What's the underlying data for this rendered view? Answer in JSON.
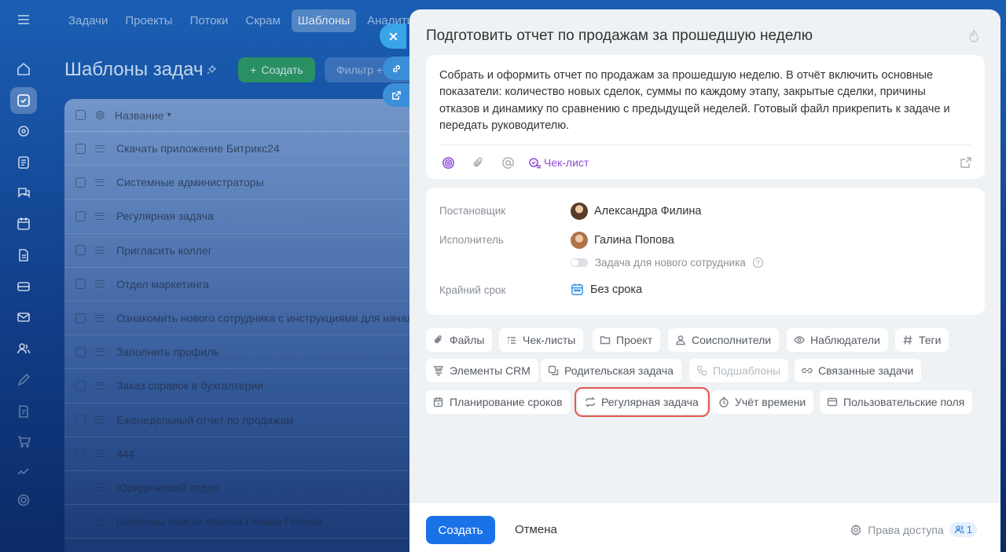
{
  "topnav": {
    "tabs": [
      "Задачи",
      "Проекты",
      "Потоки",
      "Скрам",
      "Шаблоны",
      "Аналити"
    ],
    "active_tab": "Шаблоны"
  },
  "page": {
    "title": "Шаблоны задач",
    "create_label": "Создать",
    "filter_placeholder": "Фильтр +"
  },
  "list": {
    "header": "Название",
    "rows": [
      "Скачать приложение Битрикс24",
      "Системные администраторы",
      "Регулярная задача",
      "Пригласить коллег",
      "Отдел маркетинга",
      "Ознакомить нового сотрудника с инструкциями для начала",
      "Заполнить профиль",
      "Заказ справок в бухгалтерии",
      "Еженедельный отчет по продажам",
      "444",
      "Юридический отдел",
      "Шаблоны поиски отмена Галина Попова"
    ]
  },
  "panel": {
    "title": "Подготовить отчет по продажам за прошедшую неделю",
    "description": "Собрать и оформить отчет по продажам за прошедшую неделю. В отчёт включить основные показатели: количество новых сделок, суммы по каждому этапу, закрытые сделки, причины отказов и динамику по сравнению с предыдущей неделей. Готовый файл прикрепить к задаче и передать руководителю.",
    "checklist_link": "Чек-лист",
    "fields": {
      "creator_label": "Постановщик",
      "creator_name": "Александра Филина",
      "assignee_label": "Исполнитель",
      "assignee_name": "Галина Попова",
      "new_employee_toggle": "Задача для нового сотрудника",
      "deadline_label": "Крайний срок",
      "deadline_value": "Без срока"
    },
    "chips": {
      "files": "Файлы",
      "checklists": "Чек-листы",
      "project": "Проект",
      "co_executors": "Соисполнители",
      "observers": "Наблюдатели",
      "tags": "Теги",
      "crm": "Элементы CRM",
      "parent_task": "Родительская задача",
      "subtemplates": "Подшаблоны",
      "related_tasks": "Связанные задачи",
      "planning": "Планирование сроков",
      "recurring": "Регулярная задача",
      "time_tracking": "Учёт времени",
      "custom_fields": "Пользовательские поля"
    },
    "footer": {
      "create": "Создать",
      "cancel": "Отмена",
      "access": "Права доступа",
      "access_count": "1"
    }
  },
  "colors": {
    "accent": "#1a72e8",
    "highlight": "#e5574e",
    "checklist": "#8c4ad9"
  }
}
